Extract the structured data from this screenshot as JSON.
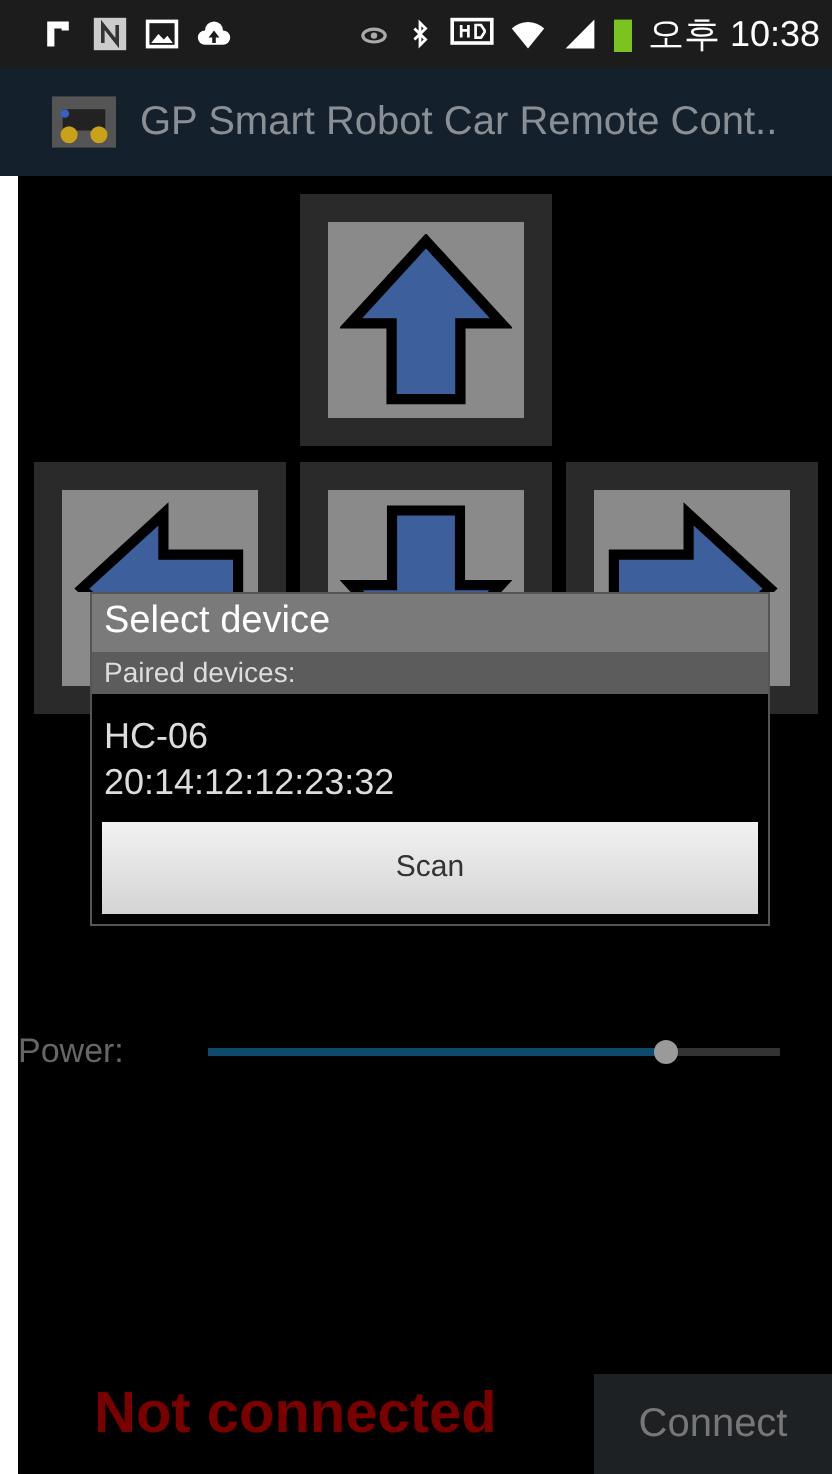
{
  "status_bar": {
    "time": "오후 10:38"
  },
  "app_bar": {
    "title": "GP Smart Robot Car Remote Cont.."
  },
  "dpad": [
    {
      "kind": "up"
    },
    {
      "kind": "left"
    },
    {
      "kind": "down"
    },
    {
      "kind": "right"
    }
  ],
  "dialog": {
    "title": "Select device",
    "section_header": "Paired devices:",
    "devices": [
      {
        "name": "HC-06",
        "address": "20:14:12:12:23:32"
      }
    ],
    "button": "Scan"
  },
  "power": {
    "label": "Power:",
    "level": 0.8
  },
  "connection": {
    "status": "Not connected",
    "button": "Connect"
  }
}
